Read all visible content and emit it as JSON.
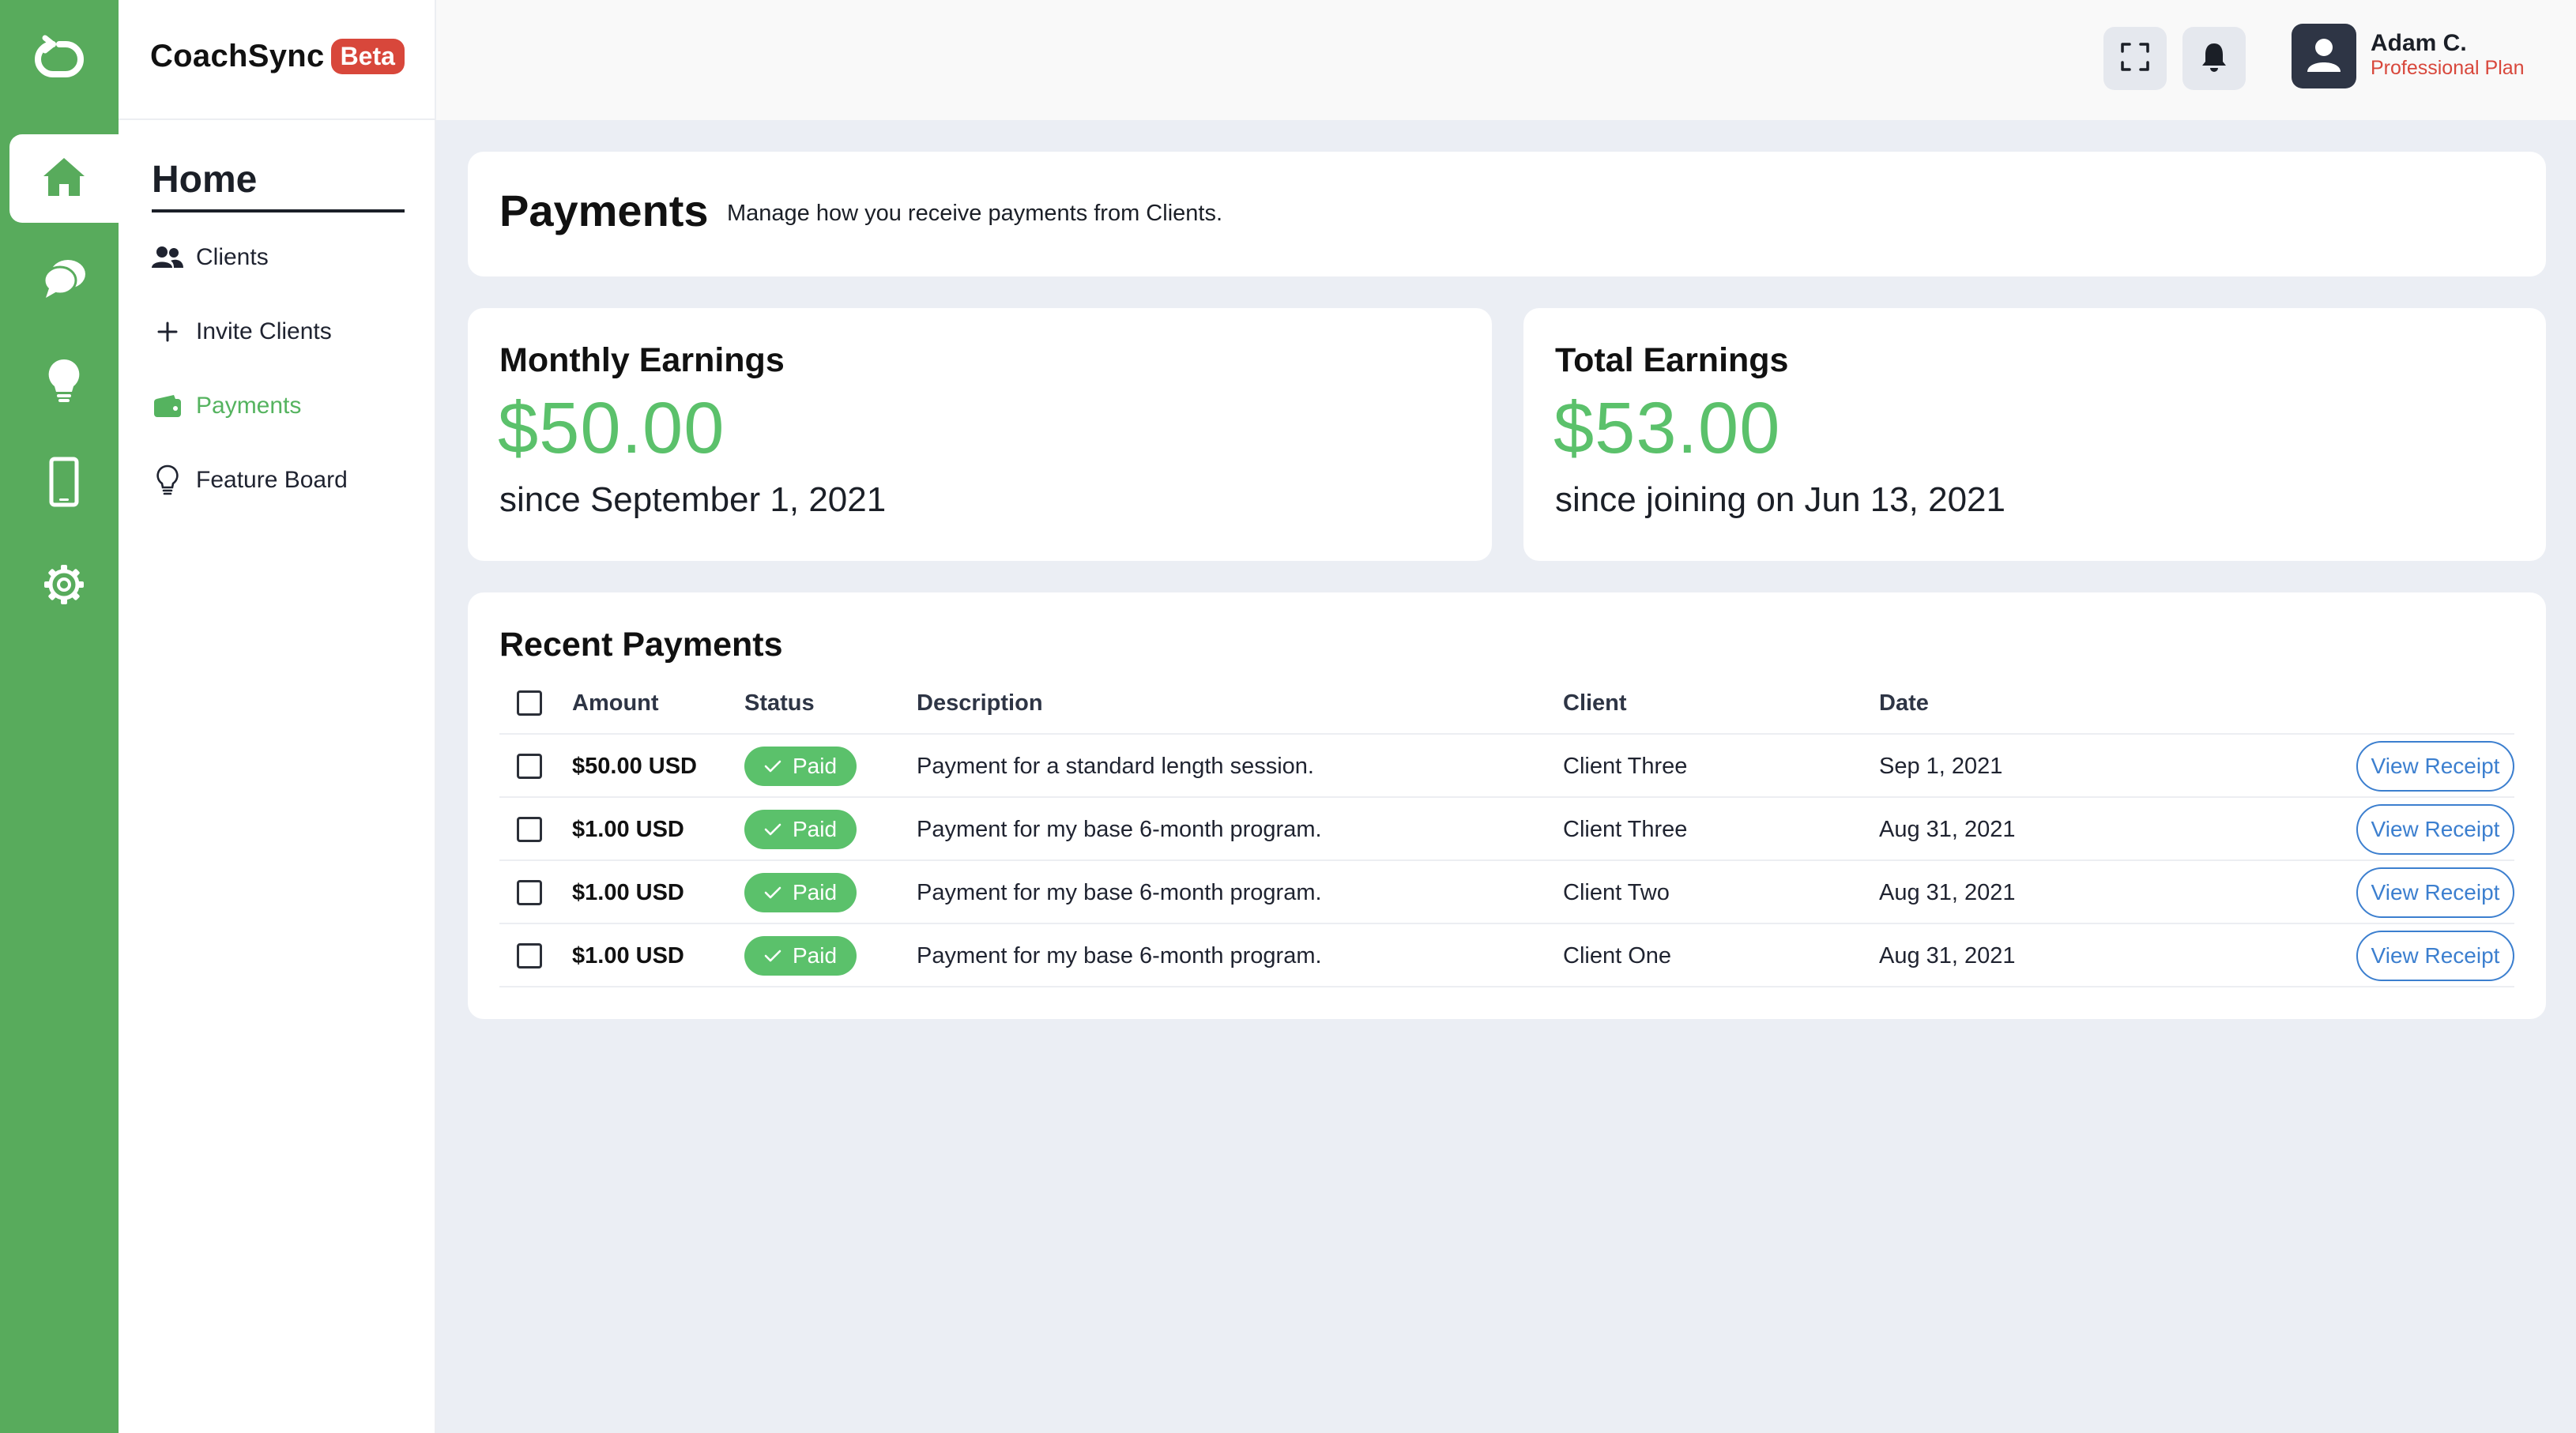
{
  "brand": {
    "name": "CoachSync",
    "badge": "Beta"
  },
  "rail": {
    "items": [
      {
        "icon": "home-icon",
        "active": true
      },
      {
        "icon": "chat-bubbles-icon",
        "active": false
      },
      {
        "icon": "lightbulb-icon",
        "active": false
      },
      {
        "icon": "mobile-phone-icon",
        "active": false
      },
      {
        "icon": "gear-icon",
        "active": false
      }
    ]
  },
  "sidebar": {
    "section_title": "Home",
    "items": [
      {
        "label": "Clients",
        "icon": "people-icon"
      },
      {
        "label": "Invite Clients",
        "icon": "plus-icon"
      },
      {
        "label": "Payments",
        "icon": "wallet-icon",
        "active": true
      },
      {
        "label": "Feature Board",
        "icon": "lightbulb-outline-icon"
      }
    ]
  },
  "topbar": {
    "user_name": "Adam C.",
    "user_plan": "Professional Plan"
  },
  "page": {
    "title": "Payments",
    "subtitle": "Manage how you receive payments from Clients."
  },
  "earnings": {
    "monthly": {
      "title": "Monthly Earnings",
      "amount": "$50.00",
      "since": "since September 1, 2021"
    },
    "total": {
      "title": "Total Earnings",
      "amount": "$53.00",
      "since": "since joining on Jun 13, 2021"
    }
  },
  "recent_payments": {
    "title": "Recent Payments",
    "columns": {
      "amount": "Amount",
      "status": "Status",
      "description": "Description",
      "client": "Client",
      "date": "Date"
    },
    "rows": [
      {
        "amount": "$50.00 USD",
        "status": "Paid",
        "description": "Payment for a standard length session.",
        "client": "Client Three",
        "date": "Sep 1, 2021",
        "action": "View Receipt"
      },
      {
        "amount": "$1.00 USD",
        "status": "Paid",
        "description": "Payment for my base 6-month program.",
        "client": "Client Three",
        "date": "Aug 31, 2021",
        "action": "View Receipt"
      },
      {
        "amount": "$1.00 USD",
        "status": "Paid",
        "description": "Payment for my base 6-month program.",
        "client": "Client Two",
        "date": "Aug 31, 2021",
        "action": "View Receipt"
      },
      {
        "amount": "$1.00 USD",
        "status": "Paid",
        "description": "Payment for my base 6-month program.",
        "client": "Client One",
        "date": "Aug 31, 2021",
        "action": "View Receipt"
      }
    ]
  },
  "colors": {
    "brand_green": "#58ab5c",
    "accent_green": "#5bc16b",
    "badge_red": "#d8473b",
    "link_blue": "#3c7fcf"
  }
}
